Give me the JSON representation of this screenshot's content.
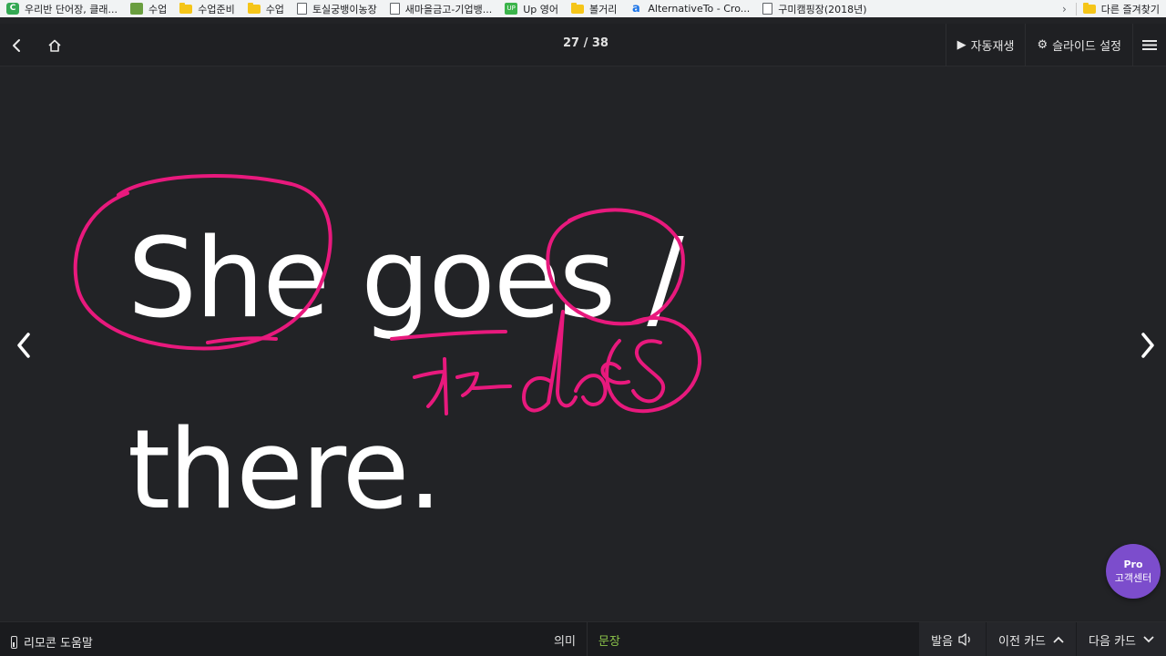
{
  "bookmarks": [
    {
      "icon": "green-app-icon",
      "label": "우리반 단어장, 클래..."
    },
    {
      "icon": "picture-icon",
      "label": "수업"
    },
    {
      "icon": "folder-icon",
      "label": "수업준비"
    },
    {
      "icon": "folder-icon",
      "label": "수업"
    },
    {
      "icon": "page-icon",
      "label": "토실궁뱅이농장"
    },
    {
      "icon": "page-icon",
      "label": "새마을금고-기업뱅..."
    },
    {
      "icon": "up-icon",
      "label": "Up 영어"
    },
    {
      "icon": "folder-icon",
      "label": "볼거리"
    },
    {
      "icon": "a-logo-icon",
      "label": "AlternativeTo - Cro..."
    },
    {
      "icon": "page-icon",
      "label": "구미캠핑장(2018년)"
    }
  ],
  "bookmarks_other": "다른 즐겨찾기",
  "topbar": {
    "counter": "27 / 38",
    "autoplay": "자동재생",
    "slide_settings": "슬라이드 설정"
  },
  "slide": {
    "sentence_line1": "She goes /",
    "sentence_line2": "there.",
    "handwriting": "가기 does"
  },
  "pro": {
    "line1": "Pro",
    "line2": "고객센터"
  },
  "bottombar": {
    "remote_help": "리모콘 도움말",
    "tab_meaning": "의미",
    "tab_sentence": "문장",
    "pronunciation": "발음",
    "prev_card": "이전 카드",
    "next_card": "다음 카드"
  },
  "colors": {
    "background": "#222326",
    "ink": "#e8197d",
    "active_tab": "#8bc34a",
    "pro_button": "#7c4dcc"
  }
}
